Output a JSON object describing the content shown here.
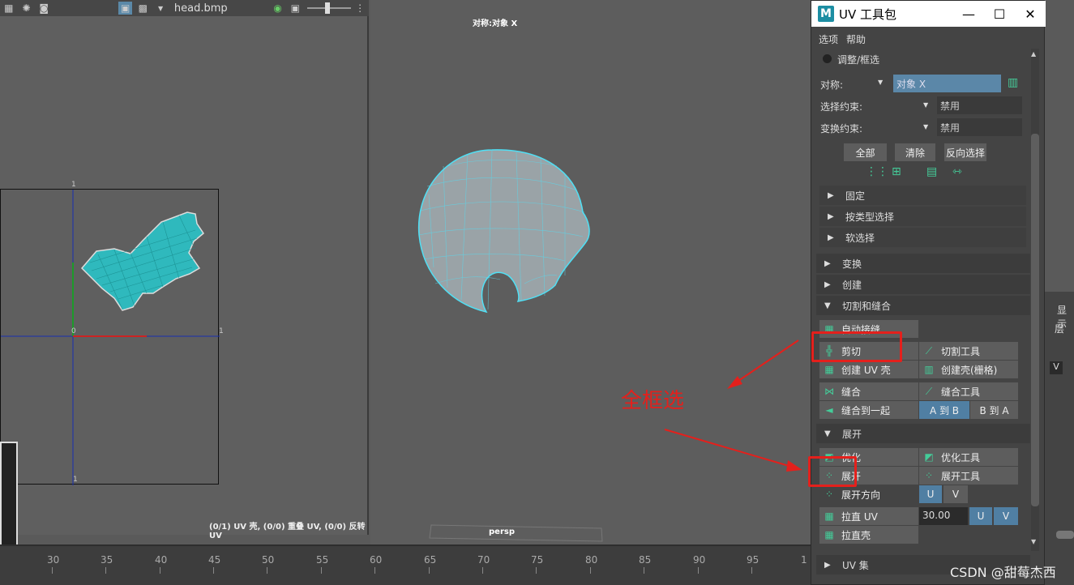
{
  "uv_editor": {
    "toolbar_icons": [
      "grid-icon",
      "sun-icon",
      "camera-icon",
      "image-icon",
      "checker-icon",
      "dropdown-icon"
    ],
    "texture_name": "head.bmp",
    "right_icons": [
      "rgb-icon",
      "image-icon",
      "slider-icon"
    ],
    "axis_label_top": "1",
    "axis_label_origin": "0",
    "axis_label_right": "1",
    "axis_label_bottom": "1",
    "status": "(0/1) UV 壳, (0/0) 重叠 UV, (0/0) 反转 UV"
  },
  "viewport": {
    "title": "对称:对象 X",
    "camera": "persp"
  },
  "timeline": {
    "ticks": [
      "30",
      "35",
      "40",
      "45",
      "50",
      "55",
      "60",
      "65",
      "70",
      "75",
      "80",
      "85",
      "90",
      "95",
      "1"
    ]
  },
  "toolkit": {
    "title": "UV 工具包",
    "menu": [
      "选项",
      "帮助"
    ],
    "adjust_label": "调整/框选",
    "symmetry_label": "对称:",
    "symmetry_value": "对象 X",
    "select_constraint_label": "选择约束:",
    "select_constraint_value": "禁用",
    "transform_constraint_label": "变换约束:",
    "transform_constraint_value": "禁用",
    "btn_all": "全部",
    "btn_clear": "清除",
    "btn_invert": "反向选择",
    "sub_sections": [
      "固定",
      "按类型选择",
      "软选择"
    ],
    "sections": [
      "变换",
      "创建",
      "切割和缝合",
      "展开",
      "UV 集"
    ],
    "cut": {
      "auto_seams": "自动接缝",
      "cut": "剪切",
      "cut_tool": "切割工具",
      "create_uv_shell": "创建 UV 壳",
      "create_shell_grid": "创建壳(栅格)",
      "sew": "缝合",
      "sew_tool": "缝合工具",
      "sew_together": "缝合到一起",
      "a_to_b": "A 到 B",
      "b_to_a": "B 到 A"
    },
    "unfold": {
      "optimize": "优化",
      "optimize_tool": "优化工具",
      "unfold": "展开",
      "unfold_tool": "展开工具",
      "unfold_direction": "展开方向",
      "u": "U",
      "v": "V",
      "straighten_uv": "拉直 UV",
      "straighten_value": "30.00",
      "straighten_shell": "拉直壳"
    }
  },
  "right_panel": {
    "label1": "显示",
    "label2": "层",
    "v": "V"
  },
  "annotation": "全框选",
  "watermark": "CSDN @甜莓杰西"
}
